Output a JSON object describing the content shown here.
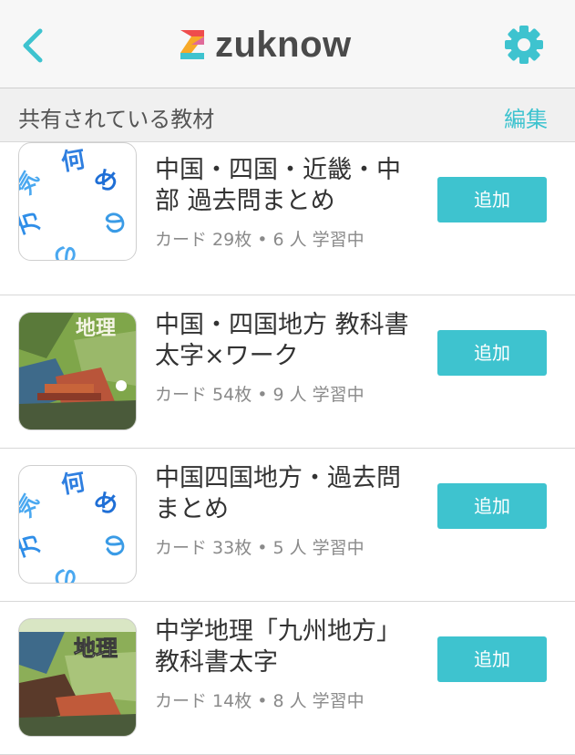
{
  "header": {
    "app_name": "zuknow",
    "back_icon": "chevron-left-icon",
    "settings_icon": "gear-icon",
    "accent_color": "#3ec3cf"
  },
  "section": {
    "title": "共有されている教材",
    "edit_label": "編集"
  },
  "items": [
    {
      "title": "中国・四国・近畿・中部 過去問まとめ",
      "meta": "カード 29枚 • 6 人 学習中",
      "add_label": "追加",
      "thumb": "circle-characters"
    },
    {
      "title": "中国・四国地方 教科書太字×ワーク",
      "meta": "カード 54枚 • 9 人 学習中",
      "add_label": "追加",
      "thumb": "geography-textbook"
    },
    {
      "title": "中国四国地方・過去問まとめ",
      "meta": "カード 33枚 • 5 人 学習中",
      "add_label": "追加",
      "thumb": "circle-characters"
    },
    {
      "title": "中学地理「九州地方」教科書太字",
      "meta": "カード 14枚 • 8 人 学習中",
      "add_label": "追加",
      "thumb": "geography-textbook"
    }
  ],
  "thumb_text": {
    "geography": "地理"
  }
}
